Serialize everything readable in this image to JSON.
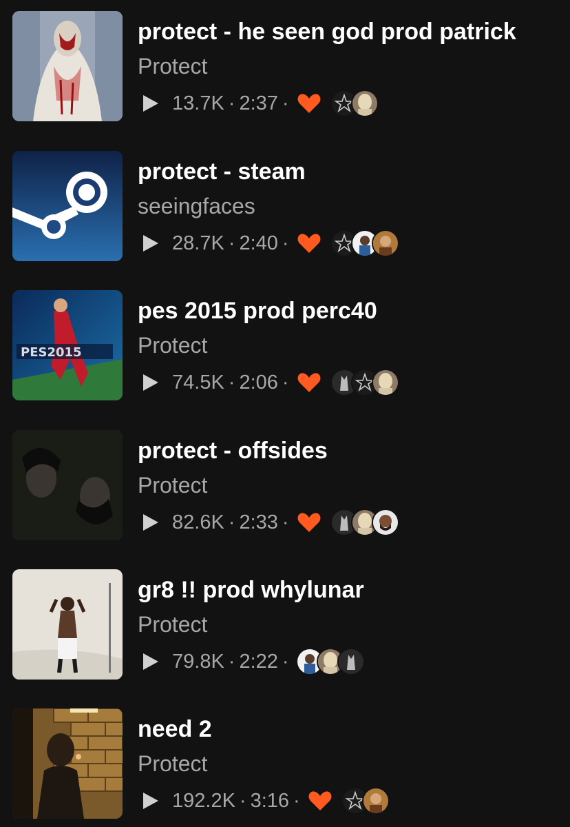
{
  "colors": {
    "background": "#121212",
    "title": "#ffffff",
    "secondary": "#a8a8a8",
    "heart": "#ff5a1f"
  },
  "separator": "·",
  "tracks": [
    {
      "title": "protect - he seen god prod patrick",
      "artist": "Protect",
      "plays": "13.7K",
      "duration": "2:37",
      "liked": true,
      "cover": "statue",
      "avatars": [
        "star",
        "blonde"
      ]
    },
    {
      "title": "protect - steam",
      "artist": "seeingfaces",
      "plays": "28.7K",
      "duration": "2:40",
      "liked": true,
      "cover": "steam-logo",
      "avatars": [
        "star",
        "white-guy",
        "orange-guy"
      ]
    },
    {
      "title": "pes 2015 prod perc40",
      "artist": "Protect",
      "plays": "74.5K",
      "duration": "2:06",
      "liked": true,
      "cover": "soccer-game",
      "avatars": [
        "dark-figure",
        "star",
        "blonde"
      ]
    },
    {
      "title": "protect - offsides",
      "artist": "Protect",
      "plays": "82.6K",
      "duration": "2:33",
      "liked": true,
      "cover": "mirrored-face",
      "avatars": [
        "dark-figure",
        "blonde",
        "bearded"
      ]
    },
    {
      "title": "gr8 !! prod whylunar",
      "artist": "Protect",
      "plays": "79.8K",
      "duration": "2:22",
      "liked": false,
      "cover": "studio-figure",
      "avatars": [
        "white-guy",
        "blonde",
        "dark-figure"
      ]
    },
    {
      "title": "need 2",
      "artist": "Protect",
      "plays": "192.2K",
      "duration": "3:16",
      "liked": true,
      "cover": "brick-wall",
      "avatars": [
        "star",
        "orange-guy"
      ]
    }
  ]
}
